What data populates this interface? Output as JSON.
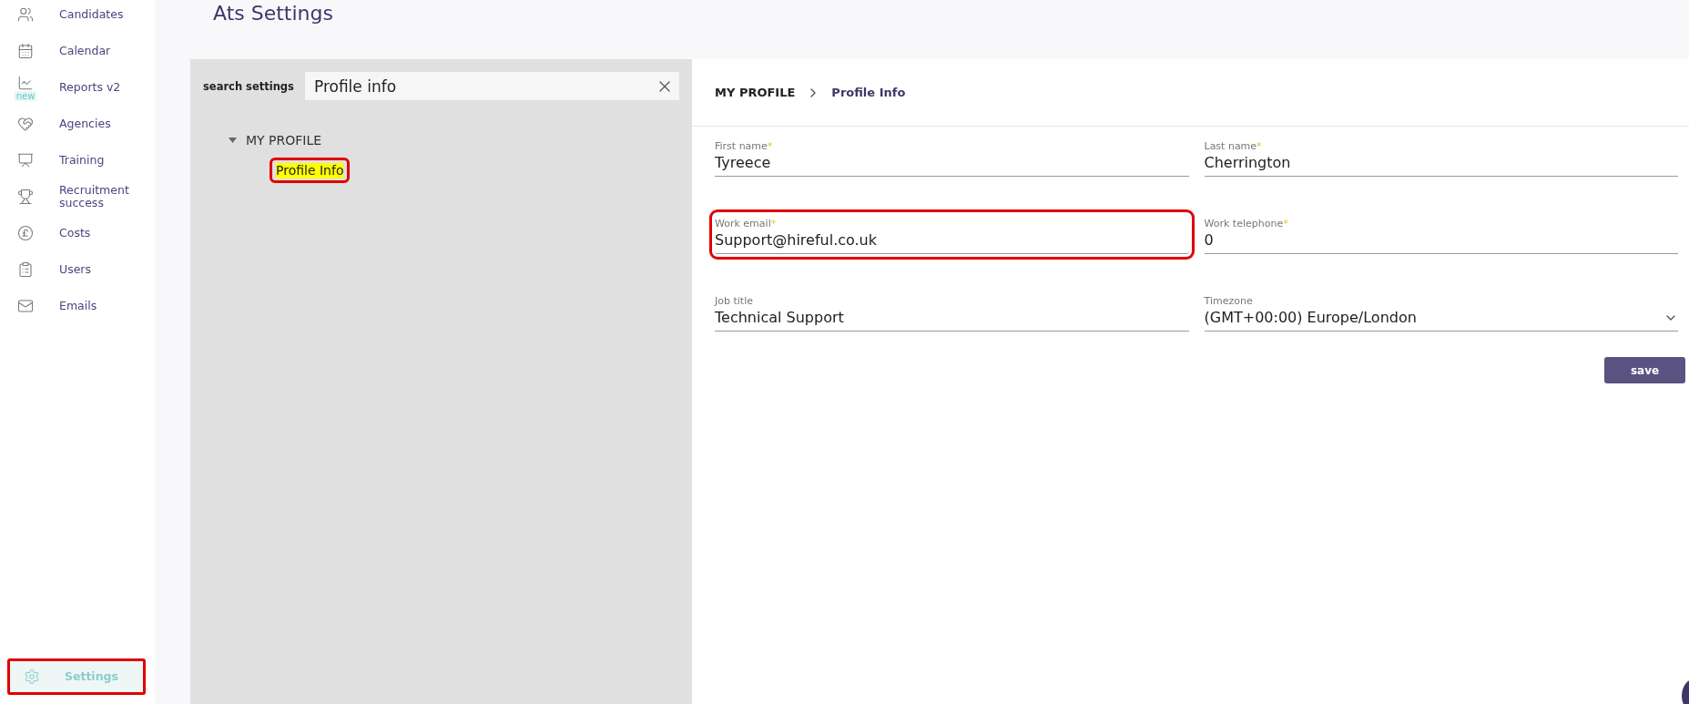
{
  "sidebar": {
    "items": [
      {
        "label": "Candidates",
        "selected": false
      },
      {
        "label": "Calendar",
        "selected": false
      },
      {
        "label": "Reports v2",
        "badge": "new",
        "selected": false
      },
      {
        "label": "Agencies",
        "selected": false
      },
      {
        "label": "Training",
        "selected": false
      },
      {
        "label": "Recruitment success",
        "selected": false
      },
      {
        "label": "Costs",
        "selected": false
      },
      {
        "label": "Users",
        "selected": false
      },
      {
        "label": "Emails",
        "selected": false
      }
    ],
    "footer_item": {
      "label": "Settings",
      "selected": true,
      "highlighted": true
    }
  },
  "page_title": "Ats Settings",
  "settings_tree": {
    "search_label": "search settings",
    "search_value": "Profile info",
    "groups": [
      {
        "label": "MY PROFILE",
        "expanded": true,
        "children": [
          {
            "label": "Profile Info",
            "selected": true,
            "highlighted": true
          }
        ]
      }
    ]
  },
  "breadcrumb": [
    "MY PROFILE",
    "Profile Info"
  ],
  "form": {
    "fields": [
      {
        "kind": "text",
        "label": "First name",
        "required_mark": "*",
        "value": "Tyreece",
        "highlighted": false
      },
      {
        "kind": "text",
        "label": "Last name",
        "required_mark": "*",
        "value": "Cherrington",
        "highlighted": false
      },
      {
        "kind": "text",
        "label": "Work email",
        "required_mark": "*",
        "value": "Support@hireful.co.uk",
        "highlighted": true
      },
      {
        "kind": "text",
        "label": "Work telephone",
        "required_mark": "*",
        "value": "0",
        "highlighted": false
      },
      {
        "kind": "text",
        "label": "Job title",
        "value": "Technical Support",
        "highlighted": false
      },
      {
        "kind": "select",
        "label": "Timezone",
        "value": "(GMT+00:00) Europe/London",
        "highlighted": false
      }
    ],
    "submit": "save"
  }
}
